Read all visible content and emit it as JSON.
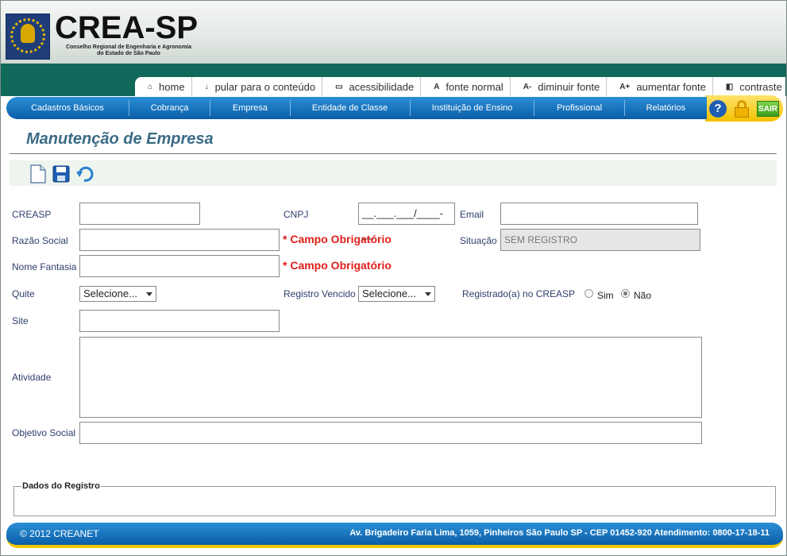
{
  "logo": {
    "title": "CREA-SP",
    "subtitle_line1": "Conselho Regional de Engenharia e Agronomia",
    "subtitle_line2": "do Estado de São Paulo"
  },
  "accessibility": [
    {
      "icon": "⌂",
      "label": "home"
    },
    {
      "icon": "↓",
      "label": "pular para o conteúdo"
    },
    {
      "icon": "▭",
      "label": "acessibilidade"
    },
    {
      "icon": "A",
      "label": "fonte normal"
    },
    {
      "icon": "A-",
      "label": "diminuir fonte"
    },
    {
      "icon": "A+",
      "label": "aumentar fonte"
    },
    {
      "icon": "◧",
      "label": "contraste"
    }
  ],
  "nav": [
    "Cadastros Básicos",
    "Cobrança",
    "Empresa",
    "Entidade de Classe",
    "Instituição de Ensino",
    "Profissional",
    "Relatórios"
  ],
  "nav_right": {
    "help": "?",
    "sair": "SAIR"
  },
  "page": {
    "title": "Manutenção de Empresa"
  },
  "form": {
    "creasp_label": "CREASP",
    "cnpj_label": "CNPJ",
    "cnpj_value": "__.___.___/____-__",
    "email_label": "Email",
    "razao_label": "Razão Social",
    "required_text": "* Campo Obrigatório",
    "situacao_label": "Situação",
    "situacao_value": "SEM REGISTRO",
    "fantasia_label": "Nome Fantasia",
    "quite_label": "Quite",
    "quite_value": "Selecione...",
    "vencido_label": "Registro Vencido",
    "vencido_value": "Selecione...",
    "registrado_label": "Registrado(a) no CREASP",
    "sim_label": "Sim",
    "nao_label": "Não",
    "site_label": "Site",
    "atividade_label": "Atividade",
    "objetivo_label": "Objetivo Social",
    "dados_legend": "Dados do Registro"
  },
  "footer": {
    "copyright": "© 2012 CREANET",
    "address": "Av. Brigadeiro Faria Lima, 1059, Pinheiros São Paulo SP - CEP 01452-920 Atendimento: 0800-17-18-11"
  }
}
